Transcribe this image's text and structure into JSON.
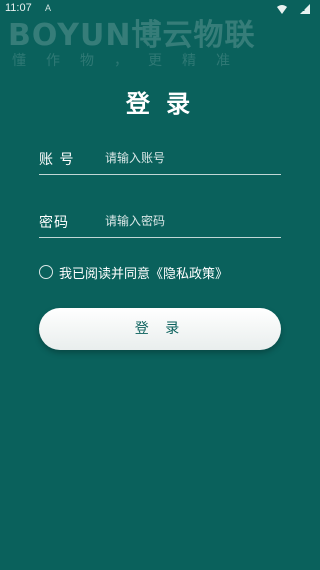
{
  "status_bar": {
    "time": "11:07",
    "indicator": "A",
    "icons": [
      "wifi-icon",
      "signal-icon"
    ]
  },
  "brand": {
    "name": "BOYUN博云物联",
    "slogan": "懂作物，更精准"
  },
  "title": "登 录",
  "account_field": {
    "label": "账 号",
    "placeholder": "请输入账号"
  },
  "password_field": {
    "label": "密码",
    "placeholder": "请输入密码"
  },
  "agreement": {
    "text": "我已阅读并同意《隐私政策》"
  },
  "login_button": {
    "label": "登 录"
  },
  "colors": {
    "background": "#0a615c",
    "button_text": "#0a615c",
    "button_bg": "#ffffff"
  }
}
